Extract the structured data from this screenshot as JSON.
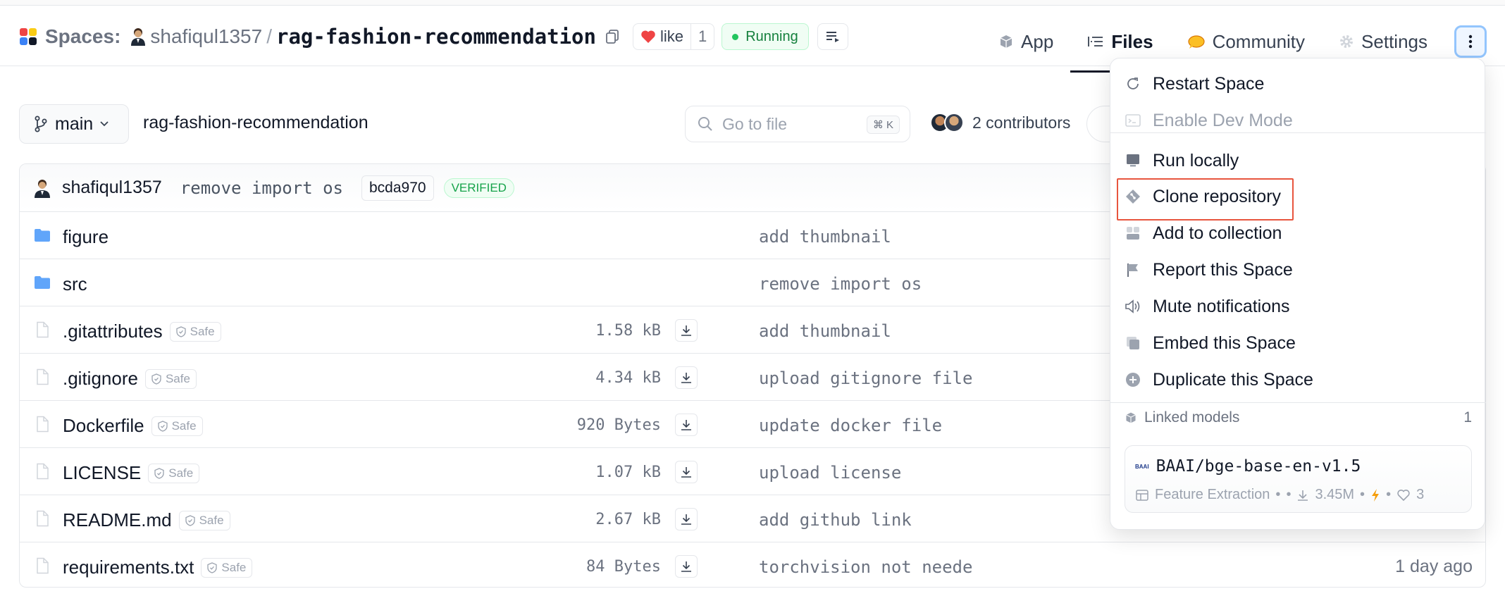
{
  "header": {
    "spaces_label": "Spaces:",
    "owner": "shafiqul1357",
    "separator": "/",
    "repo_name": "rag-fashion-recommendation",
    "like_label": "like",
    "like_count": "1",
    "status": "Running",
    "tabs": [
      {
        "label": "App",
        "icon": "cube-icon"
      },
      {
        "label": "Files",
        "icon": "files-icon"
      },
      {
        "label": "Community",
        "icon": "community-icon"
      },
      {
        "label": "Settings",
        "icon": "gear-icon"
      }
    ],
    "active_tab": "Files",
    "colors": {
      "running": "#22c55e",
      "like_heart": "#ef4444",
      "community": "#f59e0b"
    }
  },
  "toolbar": {
    "branch": "main",
    "path": "rag-fashion-recommendation",
    "search_placeholder": "Go to file",
    "search_shortcut": "⌘ K",
    "contributors": "2 contributors"
  },
  "commit": {
    "author": "shafiqul1357",
    "message": "remove import os",
    "sha": "bcda970",
    "badge": "VERIFIED"
  },
  "files": [
    {
      "name": "figure",
      "type": "folder",
      "safe": "",
      "size": "",
      "message": "add thumbnail",
      "date": ""
    },
    {
      "name": "src",
      "type": "folder",
      "safe": "",
      "size": "",
      "message": "remove import os",
      "date": ""
    },
    {
      "name": ".gitattributes",
      "type": "file",
      "safe": "Safe",
      "size": "1.58 kB",
      "message": "add thumbnail",
      "date": ""
    },
    {
      "name": ".gitignore",
      "type": "file",
      "safe": "Safe",
      "size": "4.34 kB",
      "message": "upload gitignore file",
      "date": ""
    },
    {
      "name": "Dockerfile",
      "type": "file",
      "safe": "Safe",
      "size": "920 Bytes",
      "message": "update docker file",
      "date": ""
    },
    {
      "name": "LICENSE",
      "type": "file",
      "safe": "Safe",
      "size": "1.07 kB",
      "message": "upload license",
      "date": ""
    },
    {
      "name": "README.md",
      "type": "file",
      "safe": "Safe",
      "size": "2.67 kB",
      "message": "add github link",
      "date": ""
    },
    {
      "name": "requirements.txt",
      "type": "file",
      "safe": "Safe",
      "size": "84 Bytes",
      "message": "torchvision not neede",
      "date": "1 day ago"
    }
  ],
  "menu": {
    "items": [
      {
        "label": "Restart Space",
        "icon": "restart-icon",
        "disabled": false
      },
      {
        "label": "Enable Dev Mode",
        "icon": "terminal-icon",
        "disabled": true
      },
      {
        "label": "Run locally",
        "icon": "monitor-icon",
        "disabled": false
      },
      {
        "label": "Clone repository",
        "icon": "git-icon",
        "disabled": false,
        "highlighted": true
      },
      {
        "label": "Add to collection",
        "icon": "collection-icon",
        "disabled": false
      },
      {
        "label": "Report this Space",
        "icon": "flag-icon",
        "disabled": false
      },
      {
        "label": "Mute notifications",
        "icon": "speaker-mute-icon",
        "disabled": false
      },
      {
        "label": "Embed this Space",
        "icon": "embed-icon",
        "disabled": false
      },
      {
        "label": "Duplicate this Space",
        "icon": "duplicate-icon",
        "disabled": false
      }
    ],
    "linked_models_label": "Linked models",
    "linked_models_count": "1",
    "model": {
      "org_logo": "BAAI",
      "name": "BAAI/bge-base-en-v1.5",
      "task": "Feature Extraction",
      "downloads": "3.45M",
      "likes": "3"
    }
  }
}
